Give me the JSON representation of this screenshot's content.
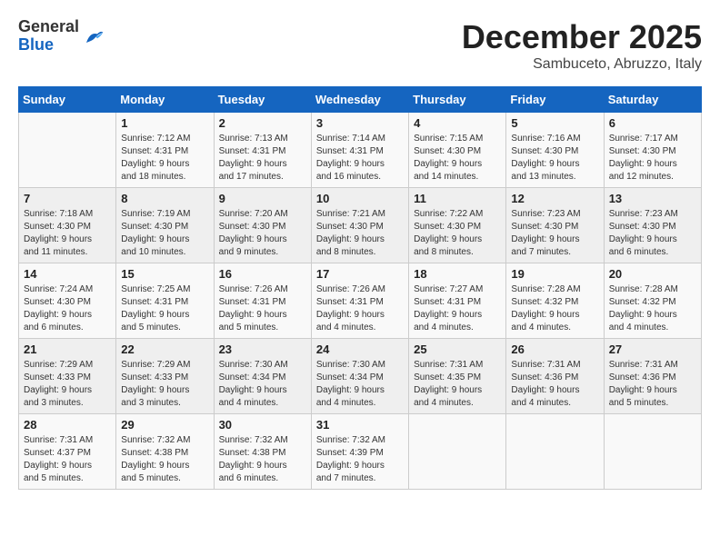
{
  "logo": {
    "general": "General",
    "blue": "Blue"
  },
  "title": "December 2025",
  "location": "Sambuceto, Abruzzo, Italy",
  "days_header": [
    "Sunday",
    "Monday",
    "Tuesday",
    "Wednesday",
    "Thursday",
    "Friday",
    "Saturday"
  ],
  "weeks": [
    [
      {
        "day": "",
        "info": ""
      },
      {
        "day": "1",
        "info": "Sunrise: 7:12 AM\nSunset: 4:31 PM\nDaylight: 9 hours\nand 18 minutes."
      },
      {
        "day": "2",
        "info": "Sunrise: 7:13 AM\nSunset: 4:31 PM\nDaylight: 9 hours\nand 17 minutes."
      },
      {
        "day": "3",
        "info": "Sunrise: 7:14 AM\nSunset: 4:31 PM\nDaylight: 9 hours\nand 16 minutes."
      },
      {
        "day": "4",
        "info": "Sunrise: 7:15 AM\nSunset: 4:30 PM\nDaylight: 9 hours\nand 14 minutes."
      },
      {
        "day": "5",
        "info": "Sunrise: 7:16 AM\nSunset: 4:30 PM\nDaylight: 9 hours\nand 13 minutes."
      },
      {
        "day": "6",
        "info": "Sunrise: 7:17 AM\nSunset: 4:30 PM\nDaylight: 9 hours\nand 12 minutes."
      }
    ],
    [
      {
        "day": "7",
        "info": "Sunrise: 7:18 AM\nSunset: 4:30 PM\nDaylight: 9 hours\nand 11 minutes."
      },
      {
        "day": "8",
        "info": "Sunrise: 7:19 AM\nSunset: 4:30 PM\nDaylight: 9 hours\nand 10 minutes."
      },
      {
        "day": "9",
        "info": "Sunrise: 7:20 AM\nSunset: 4:30 PM\nDaylight: 9 hours\nand 9 minutes."
      },
      {
        "day": "10",
        "info": "Sunrise: 7:21 AM\nSunset: 4:30 PM\nDaylight: 9 hours\nand 8 minutes."
      },
      {
        "day": "11",
        "info": "Sunrise: 7:22 AM\nSunset: 4:30 PM\nDaylight: 9 hours\nand 8 minutes."
      },
      {
        "day": "12",
        "info": "Sunrise: 7:23 AM\nSunset: 4:30 PM\nDaylight: 9 hours\nand 7 minutes."
      },
      {
        "day": "13",
        "info": "Sunrise: 7:23 AM\nSunset: 4:30 PM\nDaylight: 9 hours\nand 6 minutes."
      }
    ],
    [
      {
        "day": "14",
        "info": "Sunrise: 7:24 AM\nSunset: 4:30 PM\nDaylight: 9 hours\nand 6 minutes."
      },
      {
        "day": "15",
        "info": "Sunrise: 7:25 AM\nSunset: 4:31 PM\nDaylight: 9 hours\nand 5 minutes."
      },
      {
        "day": "16",
        "info": "Sunrise: 7:26 AM\nSunset: 4:31 PM\nDaylight: 9 hours\nand 5 minutes."
      },
      {
        "day": "17",
        "info": "Sunrise: 7:26 AM\nSunset: 4:31 PM\nDaylight: 9 hours\nand 4 minutes."
      },
      {
        "day": "18",
        "info": "Sunrise: 7:27 AM\nSunset: 4:31 PM\nDaylight: 9 hours\nand 4 minutes."
      },
      {
        "day": "19",
        "info": "Sunrise: 7:28 AM\nSunset: 4:32 PM\nDaylight: 9 hours\nand 4 minutes."
      },
      {
        "day": "20",
        "info": "Sunrise: 7:28 AM\nSunset: 4:32 PM\nDaylight: 9 hours\nand 4 minutes."
      }
    ],
    [
      {
        "day": "21",
        "info": "Sunrise: 7:29 AM\nSunset: 4:33 PM\nDaylight: 9 hours\nand 3 minutes."
      },
      {
        "day": "22",
        "info": "Sunrise: 7:29 AM\nSunset: 4:33 PM\nDaylight: 9 hours\nand 3 minutes."
      },
      {
        "day": "23",
        "info": "Sunrise: 7:30 AM\nSunset: 4:34 PM\nDaylight: 9 hours\nand 4 minutes."
      },
      {
        "day": "24",
        "info": "Sunrise: 7:30 AM\nSunset: 4:34 PM\nDaylight: 9 hours\nand 4 minutes."
      },
      {
        "day": "25",
        "info": "Sunrise: 7:31 AM\nSunset: 4:35 PM\nDaylight: 9 hours\nand 4 minutes."
      },
      {
        "day": "26",
        "info": "Sunrise: 7:31 AM\nSunset: 4:36 PM\nDaylight: 9 hours\nand 4 minutes."
      },
      {
        "day": "27",
        "info": "Sunrise: 7:31 AM\nSunset: 4:36 PM\nDaylight: 9 hours\nand 5 minutes."
      }
    ],
    [
      {
        "day": "28",
        "info": "Sunrise: 7:31 AM\nSunset: 4:37 PM\nDaylight: 9 hours\nand 5 minutes."
      },
      {
        "day": "29",
        "info": "Sunrise: 7:32 AM\nSunset: 4:38 PM\nDaylight: 9 hours\nand 5 minutes."
      },
      {
        "day": "30",
        "info": "Sunrise: 7:32 AM\nSunset: 4:38 PM\nDaylight: 9 hours\nand 6 minutes."
      },
      {
        "day": "31",
        "info": "Sunrise: 7:32 AM\nSunset: 4:39 PM\nDaylight: 9 hours\nand 7 minutes."
      },
      {
        "day": "",
        "info": ""
      },
      {
        "day": "",
        "info": ""
      },
      {
        "day": "",
        "info": ""
      }
    ]
  ]
}
